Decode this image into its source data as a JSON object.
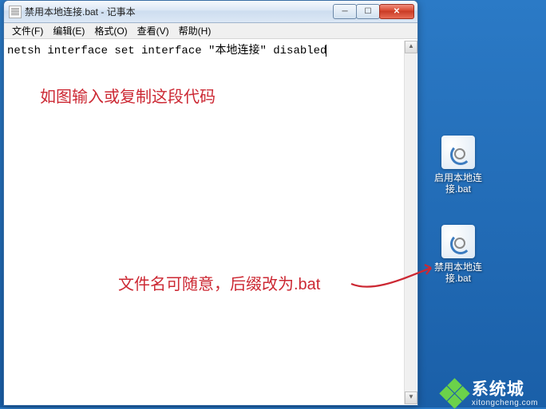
{
  "window": {
    "title": "禁用本地连接.bat - 记事本",
    "buttons": {
      "min": "─",
      "max": "☐",
      "close": "✕"
    }
  },
  "menubar": {
    "file": "文件(F)",
    "edit": "编辑(E)",
    "format": "格式(O)",
    "view": "查看(V)",
    "help": "帮助(H)"
  },
  "editor": {
    "content": "netsh interface set interface \"本地连接\" disabled"
  },
  "annotations": {
    "top": "如图输入或复制这段代码",
    "bottom": "文件名可随意，后缀改为.bat"
  },
  "desktop_icons": [
    {
      "label": "启用本地连接.bat"
    },
    {
      "label": "禁用本地连接.bat"
    }
  ],
  "watermark": {
    "cn": "系统城",
    "en": "xitongcheng.com"
  }
}
